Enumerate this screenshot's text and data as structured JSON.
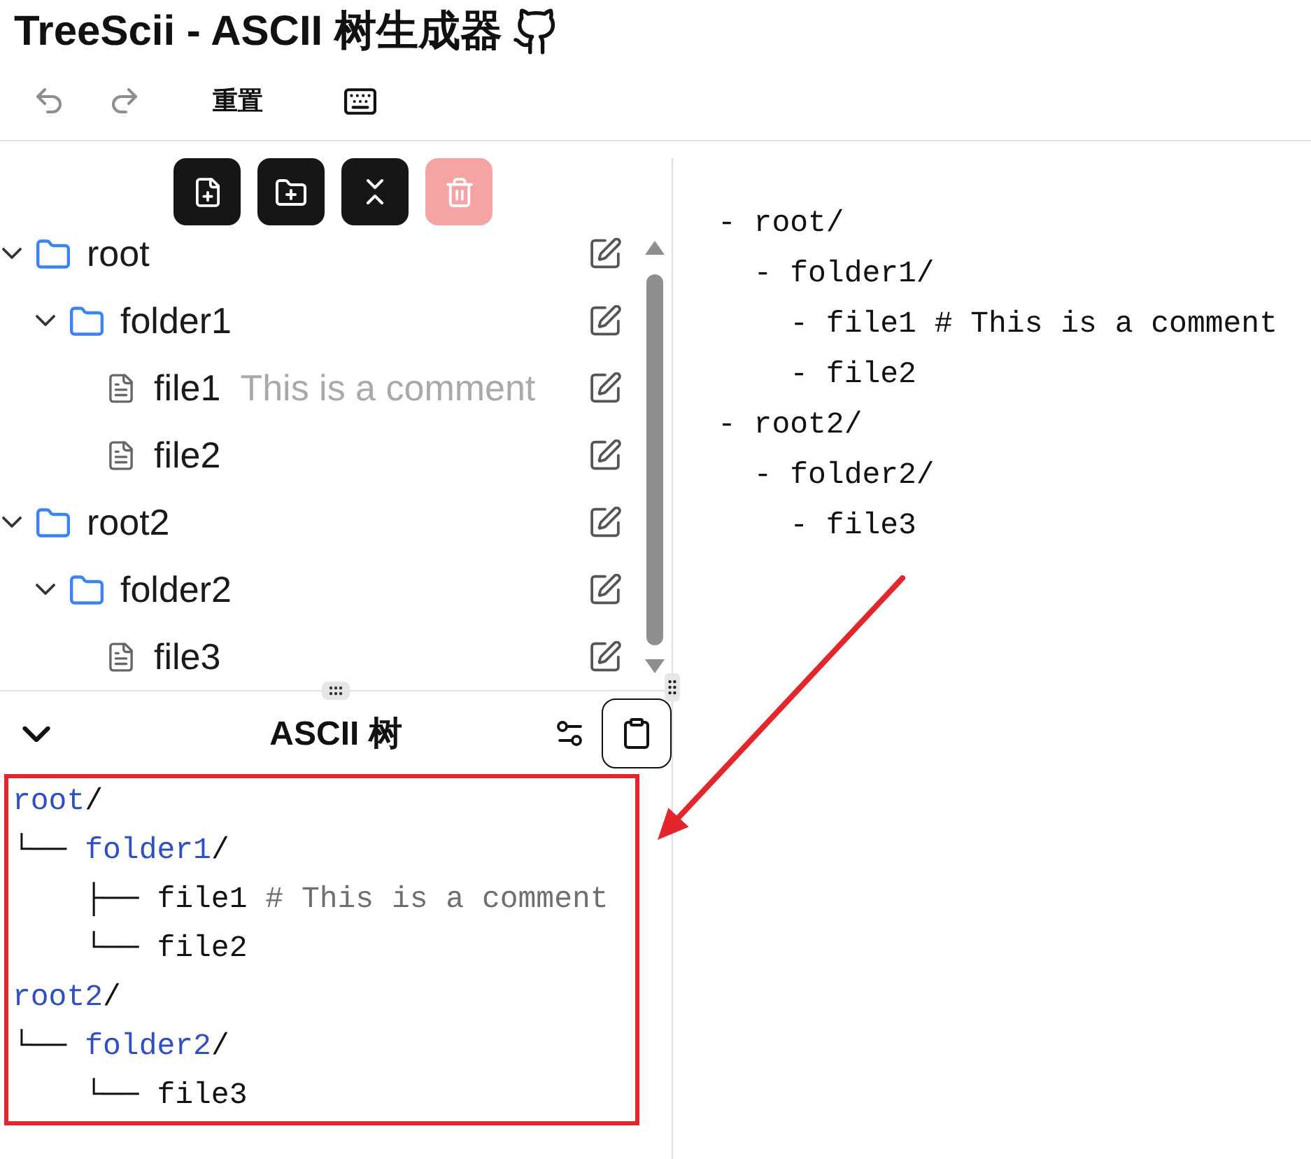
{
  "app": {
    "title": "TreeScii - ASCII 树生成器"
  },
  "toolbar": [
    {
      "kind": "undo",
      "disabled": true
    },
    {
      "kind": "redo",
      "disabled": true
    },
    {
      "kind": "text",
      "label": "重置",
      "disabled": false
    },
    {
      "kind": "keyboard",
      "disabled": false
    }
  ],
  "actions": [
    {
      "kind": "new-file",
      "disabled": false
    },
    {
      "kind": "new-folder",
      "disabled": false
    },
    {
      "kind": "collapse-all",
      "disabled": false
    },
    {
      "kind": "delete",
      "disabled": true
    }
  ],
  "tree": [
    {
      "kind": "folder",
      "name": "root",
      "expanded": true,
      "children": [
        {
          "kind": "folder",
          "name": "folder1",
          "expanded": true,
          "children": [
            {
              "kind": "file",
              "name": "file1",
              "comment": "This is a comment"
            },
            {
              "kind": "file",
              "name": "file2"
            }
          ]
        }
      ]
    },
    {
      "kind": "folder",
      "name": "root2",
      "expanded": true,
      "children": [
        {
          "kind": "folder",
          "name": "folder2",
          "expanded": true,
          "children": [
            {
              "kind": "file",
              "name": "file3"
            }
          ]
        }
      ]
    }
  ],
  "ascii_panel": {
    "title": "ASCII 树",
    "expanded": true,
    "lines": [
      {
        "kind": "folder",
        "name": "root",
        "slash": "/"
      },
      {
        "kind": "folder",
        "branch": "└──",
        "name": "folder1",
        "slash": "/"
      },
      {
        "kind": "file",
        "branch": "    ├──",
        "name": "file1",
        "comment": "# This is a comment"
      },
      {
        "kind": "file",
        "branch": "    └──",
        "name": "file2"
      },
      {
        "kind": "folder",
        "name": "root2",
        "slash": "/"
      },
      {
        "kind": "folder",
        "branch": "└──",
        "name": "folder2",
        "slash": "/"
      },
      {
        "kind": "file",
        "branch": "    └──",
        "name": "file3"
      }
    ]
  },
  "editor": {
    "lines": [
      "- root/",
      "  - folder1/",
      "    - file1 # This is a comment",
      "    - file2",
      "- root2/",
      "  - folder2/",
      "    - file3"
    ]
  },
  "annotations": {
    "highlight_box": true,
    "arrow": true
  }
}
